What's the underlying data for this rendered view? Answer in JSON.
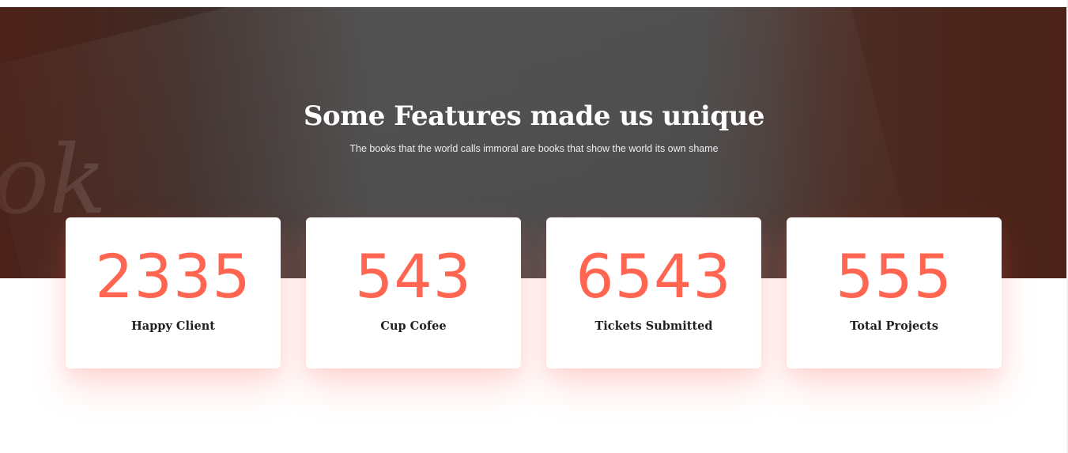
{
  "section": {
    "title": "Some Features made us unique",
    "subtitle": "The books that the world calls immoral are books that show the world its own shame"
  },
  "counters": [
    {
      "value": "2335",
      "label": "Happy Client"
    },
    {
      "value": "543",
      "label": "Cup Cofee"
    },
    {
      "value": "6543",
      "label": "Tickets Submitted"
    },
    {
      "value": "555",
      "label": "Total Projects"
    }
  ],
  "colors": {
    "accent": "#ff6550",
    "heading": "#ffffff",
    "label": "#1f1f1f"
  }
}
